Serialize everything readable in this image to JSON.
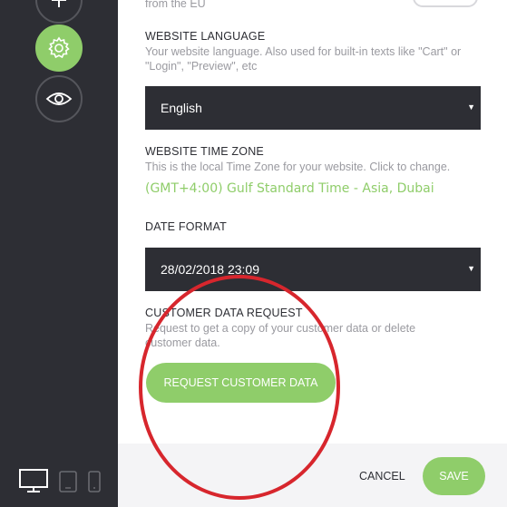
{
  "sidebar": {
    "icons": [
      "plus-icon",
      "gear-icon",
      "eye-icon"
    ],
    "devices": [
      "desktop-icon",
      "tablet-icon",
      "mobile-icon"
    ]
  },
  "settings": {
    "eu_text": "from the EU",
    "language": {
      "title": "WEBSITE LANGUAGE",
      "desc": "Your website language. Also used for built-in texts like \"Cart\" or \"Login\", \"Preview\", etc",
      "value": "English"
    },
    "timezone": {
      "title": "WEBSITE TIME ZONE",
      "desc": "This is the local Time Zone for your website. Click to change.",
      "value": "(GMT+4:00) Gulf Standard Time - Asia, Dubai"
    },
    "date_format": {
      "title": "DATE FORMAT",
      "value": "28/02/2018 23:09"
    },
    "customer_data": {
      "title": "CUSTOMER DATA REQUEST",
      "desc": "Request to get a copy of your customer data or delete customer data.",
      "button": "REQUEST CUSTOMER DATA"
    }
  },
  "footer": {
    "cancel": "CANCEL",
    "save": "SAVE"
  },
  "colors": {
    "accent": "#8fcd6a",
    "sidebar": "#2d2e34",
    "annotation": "#d7262d"
  }
}
